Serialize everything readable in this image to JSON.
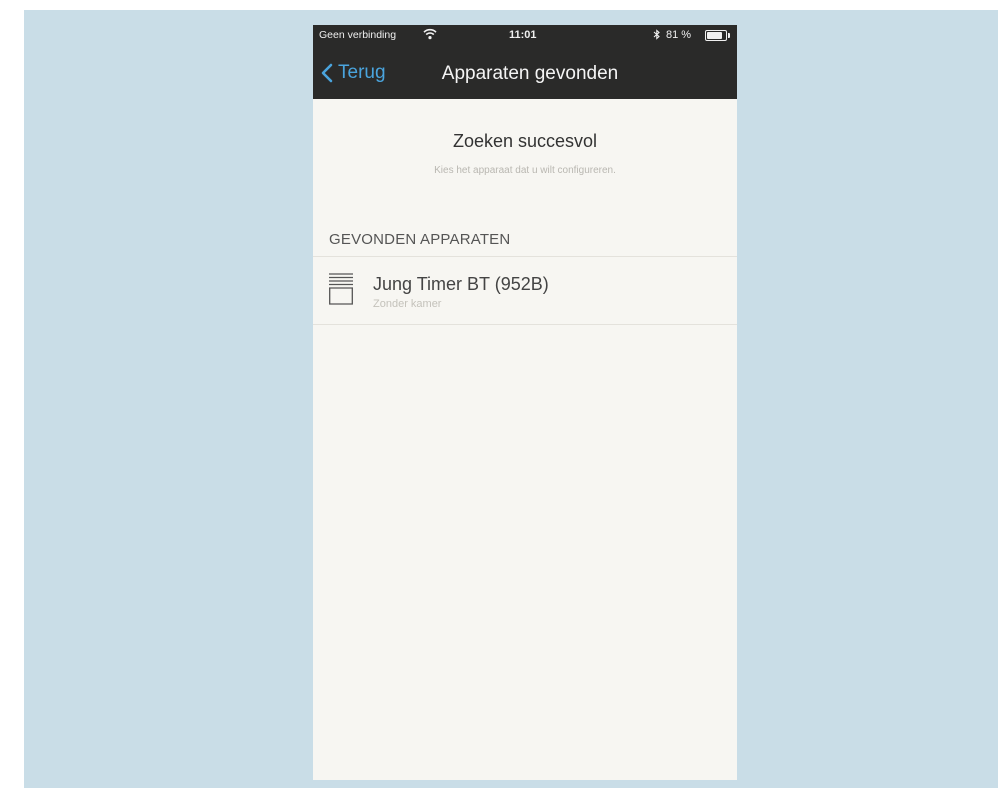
{
  "status_bar": {
    "carrier": "Geen verbinding",
    "time": "11:01",
    "bluetooth_icon": "bluetooth-icon",
    "battery": "81 %",
    "battery_level": 0.81
  },
  "nav": {
    "back_label": "Terug",
    "title": "Apparaten gevonden",
    "accent_color": "#4aa4dd"
  },
  "content": {
    "title": "Zoeken succesvol",
    "subtitle": "Kies het apparaat dat u wilt configureren."
  },
  "devices_section": {
    "header": "GEVONDEN APPARATEN",
    "items": [
      {
        "name": "Jung Timer BT (952B)",
        "room": "Zonder kamer",
        "icon": "blind-timer-icon"
      }
    ]
  }
}
